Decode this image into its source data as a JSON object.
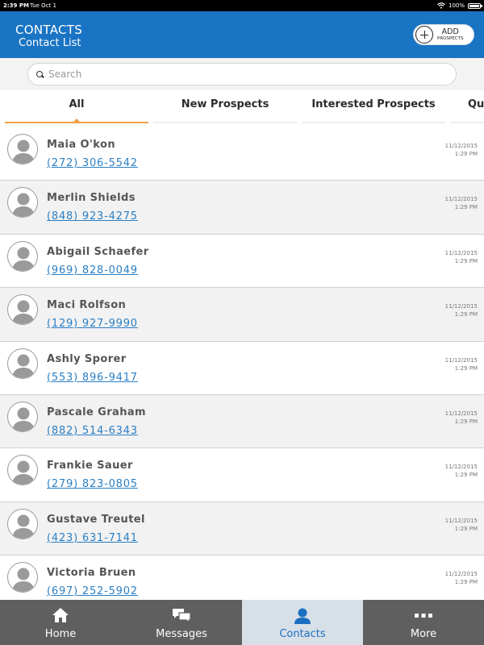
{
  "status_bar": {
    "time": "2:39 PM",
    "date": "Tue Oct 1",
    "battery": "100%"
  },
  "header": {
    "title": "CONTACTS",
    "subtitle": "Contact List",
    "add_button": {
      "line1": "ADD",
      "line2": "PROSPECTS"
    }
  },
  "search": {
    "placeholder": "Search",
    "value": ""
  },
  "tabs": [
    {
      "label": "All",
      "active": true
    },
    {
      "label": "New Prospects",
      "active": false
    },
    {
      "label": "Interested Prospects",
      "active": false
    },
    {
      "label": "Qu",
      "active": false
    }
  ],
  "contacts": [
    {
      "name": "Maia O'kon",
      "phone": "(272) 306-5542",
      "date": "11/12/2015",
      "time": "1:29 PM"
    },
    {
      "name": "Merlin Shields",
      "phone": "(848) 923-4275",
      "date": "11/12/2015",
      "time": "1:29 PM"
    },
    {
      "name": "Abigail Schaefer",
      "phone": "(969) 828-0049",
      "date": "11/12/2015",
      "time": "1:29 PM"
    },
    {
      "name": "Maci Rolfson",
      "phone": "(129) 927-9990",
      "date": "11/12/2015",
      "time": "1:29 PM"
    },
    {
      "name": "Ashly Sporer",
      "phone": "(553) 896-9417",
      "date": "11/12/2015",
      "time": "1:29 PM"
    },
    {
      "name": "Pascale Graham",
      "phone": "(882) 514-6343",
      "date": "11/12/2015",
      "time": "1:29 PM"
    },
    {
      "name": "Frankie Sauer",
      "phone": "(279) 823-0805",
      "date": "11/12/2015",
      "time": "1:29 PM"
    },
    {
      "name": "Gustave Treutel",
      "phone": "(423) 631-7141",
      "date": "11/12/2015",
      "time": "1:29 PM"
    },
    {
      "name": "Victoria Bruen",
      "phone": "(697) 252-5902",
      "date": "11/12/2015",
      "time": "1:29 PM"
    }
  ],
  "bottom_nav": [
    {
      "label": "Home",
      "icon": "home-icon",
      "active": false
    },
    {
      "label": "Messages",
      "icon": "messages-icon",
      "active": false
    },
    {
      "label": "Contacts",
      "icon": "person-icon",
      "active": true
    },
    {
      "label": "More",
      "icon": "more-icon",
      "active": false
    }
  ],
  "colors": {
    "header_bg": "#1a74c4",
    "tab_accent": "#f0a04a",
    "link": "#2a7fc4",
    "nav_bg": "#5f5f5f",
    "nav_active_bg": "#d7dfe7"
  }
}
